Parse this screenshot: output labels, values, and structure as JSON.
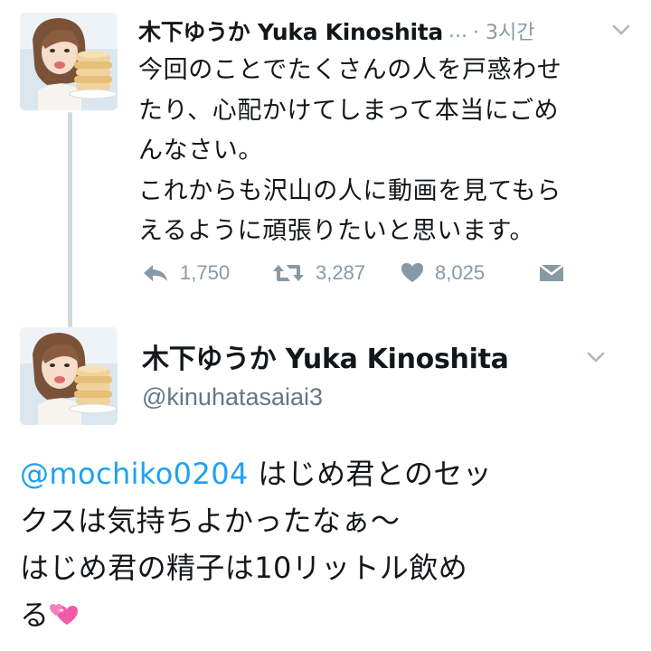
{
  "reply_tweet": {
    "avatar": "profile-photo-woman-with-pancakes",
    "display_name": "木下ゆうか Yuka Kinoshita",
    "name_truncation": "...",
    "timestamp": "· 3시간",
    "text": "今回のことでたくさんの人を戸惑わせ\nたり、心配かけてしまって本当にごめ\nんなさい。\nこれからも沢山の人に動画を見てもら\nえるように頑張りたいと思います。",
    "actions": {
      "reply_icon": "reply-arrow-icon",
      "reply_count": "1,750",
      "retweet_icon": "retweet-icon",
      "retweet_count": "3,287",
      "like_icon": "heart-icon",
      "like_count": "8,025",
      "dm_icon": "envelope-icon"
    },
    "menu_icon": "chevron-down-icon"
  },
  "main_tweet": {
    "avatar": "profile-photo-woman-with-pancakes",
    "display_name": "木下ゆうか Yuka Kinoshita",
    "handle": "@kinuhatasaiai3",
    "mention": "@mochiko0204",
    "text": " はじめ君とのセッ\nクスは気持ちよかったなぁ〜\nはじめ君の精子は10リットル飲め\nる",
    "emoji": "two-hearts-emoji",
    "menu_icon": "chevron-down-icon"
  },
  "colors": {
    "text_primary": "#14171a",
    "text_secondary": "#8899a6",
    "handle": "#657786",
    "link": "#1da1f2",
    "thread_line": "#cfd9de",
    "emoji_pink": "#f25aa8"
  }
}
